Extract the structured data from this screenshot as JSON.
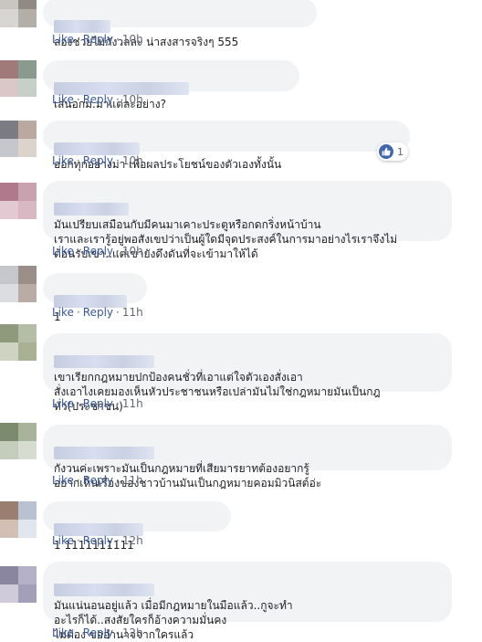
{
  "actions": {
    "like_label": "Like",
    "reply_label": "Reply",
    "separator": "·"
  },
  "comments": [
    {
      "text": "ลองช่วยไม่กังวลละ น่าสงสารจริงๆ 555",
      "time": "10h",
      "avatar_colors": [
        "#c9c6c2",
        "#8f8a84",
        "#d8d6d3",
        "#b3aea8"
      ]
    },
    {
      "text": "เสนอกม.มาแต่ละอย่าง?",
      "time": "10h",
      "avatar_colors": [
        "#a07a78",
        "#8b9a8f",
        "#d9c8c6",
        "#c7cfc9"
      ]
    },
    {
      "text": "ออกทุกอย่างมา เพื่อผลประโยชน์ของตัวเองทั้งนั้น",
      "time": "10h",
      "avatar_colors": [
        "#7a7c82",
        "#b9a9a0",
        "#c6c7cc",
        "#ddd3cd"
      ],
      "reaction_count": "1"
    },
    {
      "text": "มันเปรียบเสมือนกับมีคนมาเคาะประตูหรือกดกริ่งหน้าบ้าน\nเราและเรารู้อยู่พอสังเขปว่าเป็นผู้ใดมีจุดประสงค์ในการมาอย่างไรเราจึงไม่\nต้อนรับเขา..แต่เขายังดึงดันที่จะเข้ามาให้ได้",
      "time": "10h",
      "avatar_colors": [
        "#b07a8c",
        "#c9a2b0",
        "#e2c9d2",
        "#d9b8c4"
      ]
    },
    {
      "text": "1",
      "time": "11h",
      "avatar_colors": [
        "#c5c7cc",
        "#9a8f88",
        "#dcdde0",
        "#b8aca4"
      ]
    },
    {
      "text": "เขาเรียกกฎหมายปกป้องคนชั่วที่เอาแต่ใจตัวเองสั่งเอา\nสั่งเอาไงเคยมองเห็นหัวประชาชนหรือเปล่ามันไม่ใช่กฎหมายมันเป็นกฎ\nหัว(ประชาชน)",
      "time": "11h",
      "avatar_colors": [
        "#8f9a7c",
        "#b6bda6",
        "#cfd4c2",
        "#a9b194"
      ]
    },
    {
      "text": "กังวนค่ะเพราะมันเป็นกฎหมายที่เสียมารยาทต้องอยากรู้\nอยากเห็นเรื่องของชาวบ้านมันเป็นกฎหมายคอมมิวนิสต์อ่ะ",
      "time": "11h",
      "avatar_colors": [
        "#7c8a6e",
        "#a8b39a",
        "#c4ccbc",
        "#d6dccf"
      ]
    },
    {
      "text": "1 1111111111",
      "time": "12h",
      "avatar_colors": [
        "#9a7e6f",
        "#b9c2d0",
        "#d2c0b5",
        "#e0e5ee"
      ]
    },
    {
      "text": "มันแน่นอนอยู่แล้ว เมื่อมีกฎหมายในมือแล้ว..กูจะทำ\nอะไรก็ได้..สงสัยใครก็อ้างความมั่นคง\nไม่ต้อง ขออำนาจจากใครแล้ว",
      "time": "12h",
      "avatar_colors": [
        "#8a86a0",
        "#b4b0c6",
        "#cfcbdb",
        "#a39fb8"
      ]
    }
  ]
}
